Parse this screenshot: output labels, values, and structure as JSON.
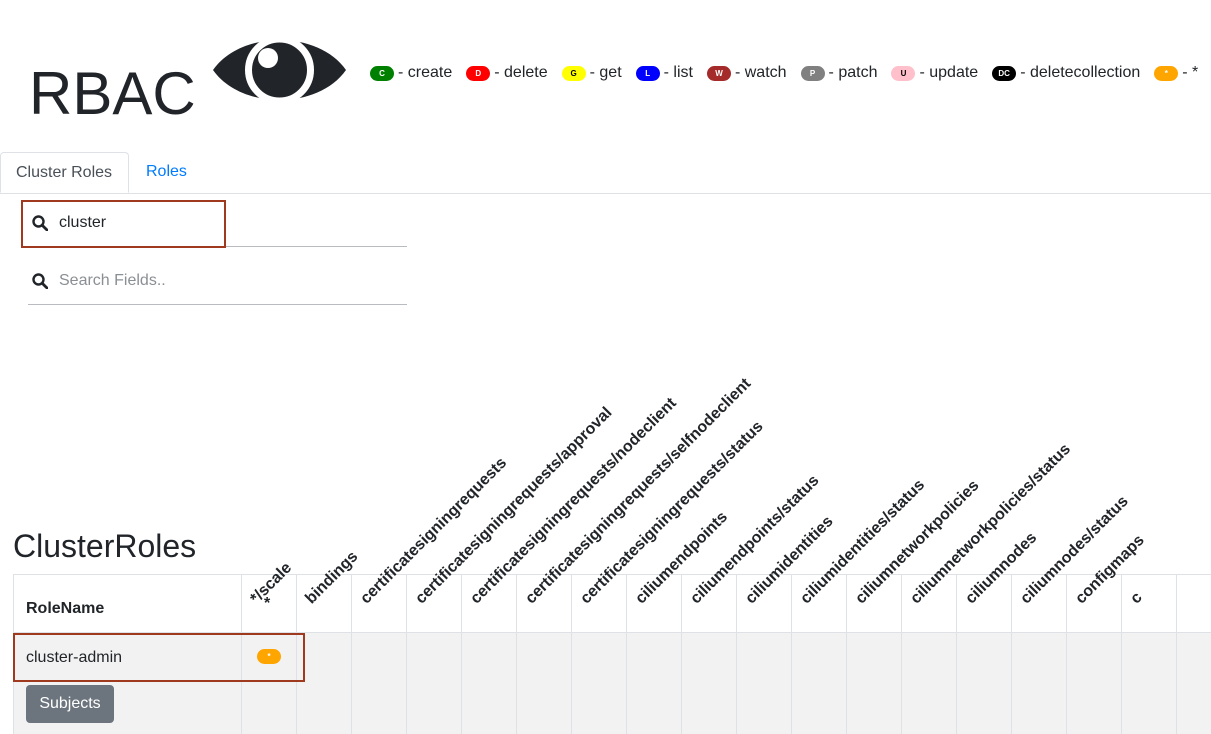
{
  "header": {
    "title": "RBAC",
    "logo_icon": "eye-icon",
    "legend": [
      {
        "code": "C",
        "label": "- create",
        "bg": "#008000",
        "fg": "#ffffff"
      },
      {
        "code": "D",
        "label": "- delete",
        "bg": "#ff0000",
        "fg": "#ffffff"
      },
      {
        "code": "G",
        "label": "- get",
        "bg": "#ffff00",
        "fg": "#000000"
      },
      {
        "code": "L",
        "label": "- list",
        "bg": "#0000ff",
        "fg": "#ffffff"
      },
      {
        "code": "W",
        "label": "- watch",
        "bg": "#a52a2a",
        "fg": "#ffffff"
      },
      {
        "code": "P",
        "label": "- patch",
        "bg": "#808080",
        "fg": "#ffffff"
      },
      {
        "code": "U",
        "label": "- update",
        "bg": "#ffc0cb",
        "fg": "#000000"
      },
      {
        "code": "DC",
        "label": "- deletecollection",
        "bg": "#000000",
        "fg": "#ffffff"
      },
      {
        "code": "*",
        "label": "- *",
        "bg": "#ffa500",
        "fg": "#ffffff"
      }
    ]
  },
  "tabs": [
    {
      "label": "Cluster Roles",
      "active": true
    },
    {
      "label": "Roles",
      "active": false
    }
  ],
  "search": {
    "role_value": "cluster",
    "fields_placeholder": "Search Fields.."
  },
  "section": {
    "heading": "ClusterRoles"
  },
  "table": {
    "rolename_header": "RoleName",
    "columns": [
      "*",
      "*/scale",
      "bindings",
      "certificatesigningrequests",
      "certificatesigningrequests/approval",
      "certificatesigningrequests/nodeclient",
      "certificatesigningrequests/selfnodeclient",
      "certificatesigningrequests/status",
      "ciliumendpoints",
      "ciliumendpoints/status",
      "ciliumidentities",
      "ciliumidentities/status",
      "ciliumnetworkpolicies",
      "ciliumnetworkpolicies/status",
      "ciliumnodes",
      "ciliumnodes/status",
      "configmaps",
      "c"
    ],
    "rows": [
      {
        "name": "cluster-admin",
        "star_badge": "*",
        "subjects_label": "Subjects"
      }
    ]
  },
  "colors": {
    "link": "#007bff",
    "highlight_border": "#a03a1e",
    "star_badge": "#ffa500",
    "subjects_button": "#6c757d"
  }
}
